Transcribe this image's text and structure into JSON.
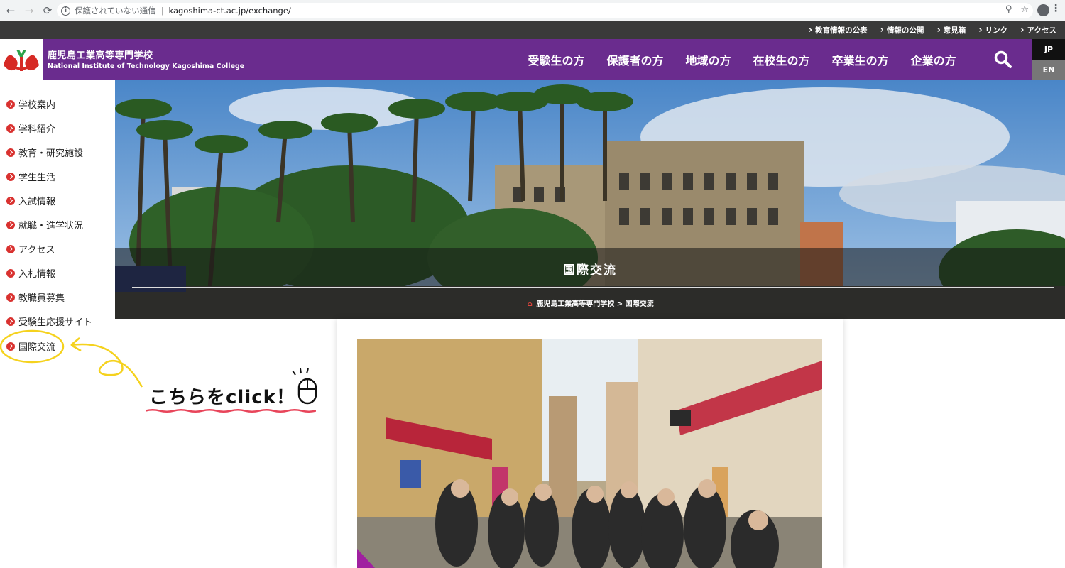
{
  "browser": {
    "security_label": "保護されていない通信",
    "url": "kagoshima-ct.ac.jp/exchange/"
  },
  "utility_links": [
    "教育情報の公表",
    "情報の公開",
    "意見箱",
    "リンク",
    "アクセス"
  ],
  "header": {
    "school_name_jp": "鹿児島工業高等専門学校",
    "school_name_en": "National Institute of Technology Kagoshima College",
    "nav": [
      "受験生の方",
      "保護者の方",
      "地域の方",
      "在校生の方",
      "卒業生の方",
      "企業の方"
    ],
    "lang_jp": "JP",
    "lang_en": "EN"
  },
  "sidebar": {
    "items": [
      "学校案内",
      "学科紹介",
      "教育・研究施設",
      "学生生活",
      "入試情報",
      "就職・進学状況",
      "アクセス",
      "入札情報",
      "教職員募集",
      "受験生応援サイト",
      "国際交流"
    ]
  },
  "hero": {
    "title": "国際交流",
    "breadcrumb_home": "鹿児島工業高等専門学校",
    "breadcrumb_sep": ">",
    "breadcrumb_current": "国際交流"
  },
  "annotation": {
    "text": "こちらをclick！"
  },
  "colors": {
    "header_purple": "#6a2c8e",
    "utility_dark": "#3a3a3a",
    "bullet_red": "#d9312f",
    "highlight_yellow": "#f5d21e"
  }
}
